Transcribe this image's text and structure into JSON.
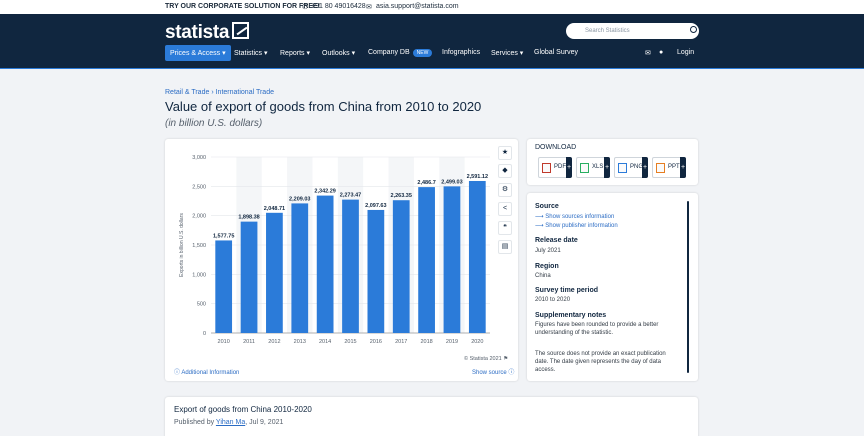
{
  "topbar": {
    "promo": "TRY OUR CORPORATE SOLUTION FOR FREE!",
    "phone": "+91 80 49016428",
    "email": "asia.support@statista.com"
  },
  "header": {
    "logo": "statista",
    "search_placeholder": "Search Statistics",
    "nav": [
      {
        "label": "Prices & Access",
        "active": true
      },
      {
        "label": "Statistics"
      },
      {
        "label": "Reports"
      },
      {
        "label": "Outlooks"
      },
      {
        "label": "Company DB",
        "badge": "NEW"
      },
      {
        "label": "Infographics"
      },
      {
        "label": "Services"
      },
      {
        "label": "Global Survey"
      }
    ],
    "login": "Login"
  },
  "breadcrumb": {
    "part1": "Retail & Trade",
    "sep": "›",
    "part2": "International Trade"
  },
  "page": {
    "title": "Value of export of goods from China from 2010 to 2020",
    "subtitle": "(in billion U.S. dollars)"
  },
  "chart_data": {
    "type": "bar",
    "categories": [
      "2010",
      "2011",
      "2012",
      "2013",
      "2014",
      "2015",
      "2016",
      "2017",
      "2018",
      "2019",
      "2020"
    ],
    "values": [
      1577.75,
      1898.38,
      2048.71,
      2209.03,
      2342.29,
      2273.47,
      2097.63,
      2263.35,
      2486.7,
      2499.03,
      2591.12
    ],
    "value_labels": [
      "1,577.75",
      "1,898.38",
      "2,048.71",
      "2,209.03",
      "2,342.29",
      "2,273.47",
      "2,097.63",
      "2,263.35",
      "2,486.7",
      "2,499.03",
      "2,591.12"
    ],
    "ylabel": "Exports in billion U.S. dollars",
    "yticks": [
      "0",
      "500",
      "1,000",
      "1,500",
      "2,000",
      "2,500",
      "3,000"
    ],
    "ylim": [
      0,
      3000
    ],
    "grid": true,
    "bar_color": "#2b7bd9"
  },
  "chart_footer": {
    "copyright": "© Statista 2021",
    "additional_info": "Additional Information",
    "show_source": "Show source"
  },
  "download": {
    "title": "DOWNLOAD",
    "formats": [
      "PDF",
      "XLS",
      "PNG",
      "PPT"
    ]
  },
  "info": {
    "source_label": "Source",
    "show_sources": "Show sources information",
    "show_publisher": "Show publisher information",
    "release_label": "Release date",
    "release_value": "July 2021",
    "region_label": "Region",
    "region_value": "China",
    "survey_label": "Survey time period",
    "survey_value": "2010 to 2020",
    "notes_label": "Supplementary notes",
    "notes_value1": "Figures have been rounded to provide a better understanding of the statistic.",
    "notes_value2": "The source does not provide an exact publication date. The date given represents the day of data access."
  },
  "description": {
    "title": "Export of goods from China 2010-2020",
    "published_by": "Published by",
    "author": "Yihan Ma",
    "date": ", Jul 9, 2021"
  }
}
